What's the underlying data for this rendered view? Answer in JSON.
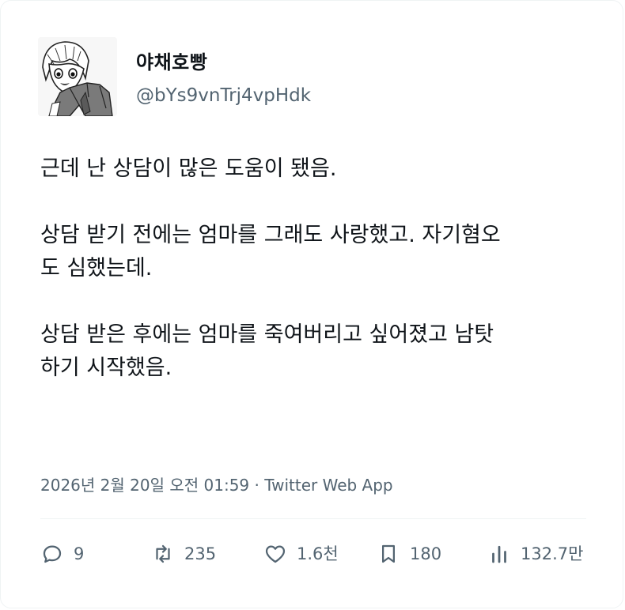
{
  "tweet": {
    "author": {
      "display_name": "야채호빵",
      "handle": "@bYs9vnTrj4vpHdk",
      "avatar_icon": "anime-character-avatar"
    },
    "paragraphs": [
      "근데 난 상담이 많은 도움이 됐음.",
      "상담 받기 전에는 엄마를 그래도 사랑했고. 자기혐오\n도 심했는데.",
      "상담 받은 후에는 엄마를 죽여버리고 싶어졌고 남탓\n하기 시작했음."
    ],
    "timestamp": "2026년 2월 20일 오전 01:59 · Twitter Web App",
    "actions": {
      "replies": "9",
      "retweets": "235",
      "likes": "1.6천",
      "bookmarks": "180",
      "views": "132.7만"
    }
  },
  "colors": {
    "text_primary": "#0f1419",
    "text_secondary": "#536471",
    "border": "#eff3f4"
  }
}
